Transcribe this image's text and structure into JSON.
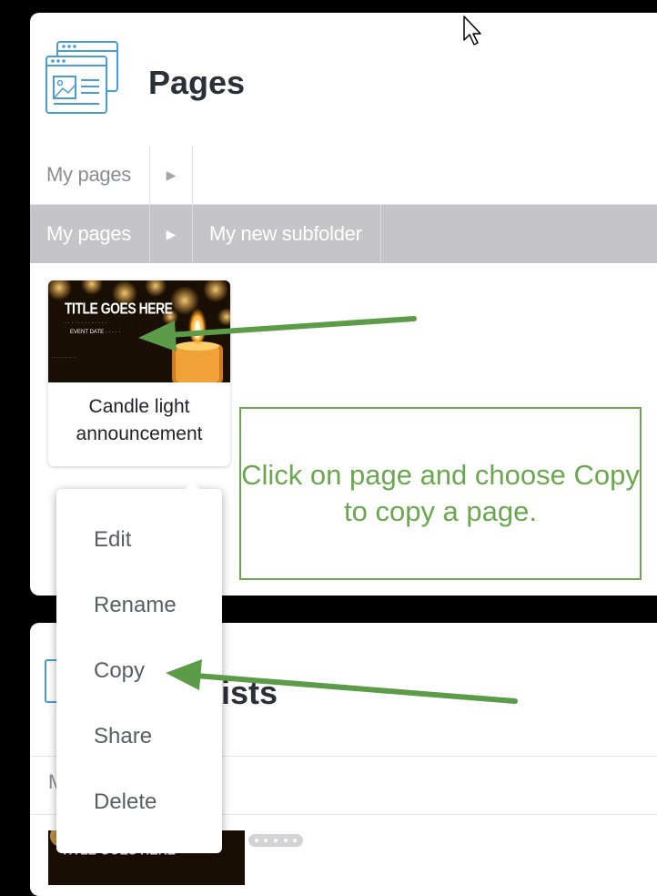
{
  "pages_card": {
    "title": "Pages",
    "breadcrumb_top": {
      "root": "My pages",
      "sep": "▶"
    },
    "breadcrumb_active": {
      "root": "My pages",
      "sep": "▶",
      "current": "My new subfolder"
    },
    "tile": {
      "thumb_title": "TITLE GOES HERE",
      "thumb_sub": "· · · · · · · · · · · · ·",
      "thumb_sub2": "EVENT DATE · · · · ·",
      "thumb_lines": ". . . . . . . . . . .",
      "name": "Candle light announcement"
    }
  },
  "callout": {
    "text": "Click on page and choose Copy to copy a page."
  },
  "lists_card": {
    "title": "lists",
    "breadcrumb": "M",
    "thumb_title": "TITLE GOES HERE"
  },
  "context_menu": {
    "items": [
      {
        "label": "Edit"
      },
      {
        "label": "Rename"
      },
      {
        "label": "Copy"
      },
      {
        "label": "Share"
      },
      {
        "label": "Delete"
      }
    ]
  },
  "colors": {
    "annotation_green": "#6aa84f",
    "arrow_green": "#5c9c48",
    "icon_blue": "#4a9bd6",
    "active_breadcrumb": "#c5c5c7"
  },
  "icons": [
    "pages-icon",
    "chevron-right-icon",
    "list-icon",
    "cursor-icon",
    "arrow-icon"
  ]
}
